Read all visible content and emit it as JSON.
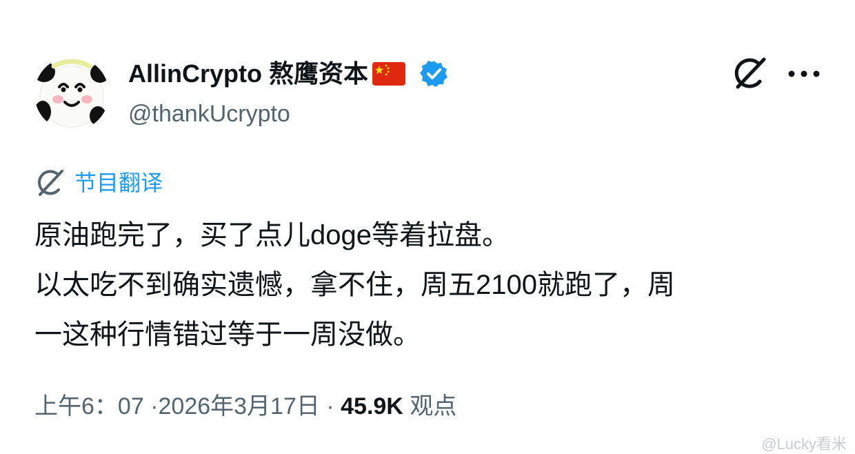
{
  "tweet": {
    "display_name": "AllinCrypto 熬鹰资本",
    "handle": "@thankUcrypto",
    "translate_label": "节目翻译",
    "text_lines": [
      "原油跑完了，买了点儿doge等着拉盘。",
      "以太吃不到确实遗憾，拿不住，周五2100就跑了，周",
      "一这种行情错过等于一周没做。"
    ],
    "time": "上午6：07",
    "date": "2026年3月17日",
    "separator": "·",
    "views_count": "45.9K",
    "views_label": "观点"
  },
  "icons": {
    "avatar": "panda-avatar",
    "flag": "china-flag-icon",
    "verified": "verified-badge-icon",
    "grok": "grok-icon",
    "more": "more-icon",
    "translate": "grok-icon"
  },
  "colors": {
    "accent": "#1d9bf0",
    "text": "#0f1419",
    "muted": "#536471",
    "flag_red": "#de2910",
    "flag_yellow": "#ffde00"
  },
  "watermark": {
    "text": "@Lucky看米"
  }
}
